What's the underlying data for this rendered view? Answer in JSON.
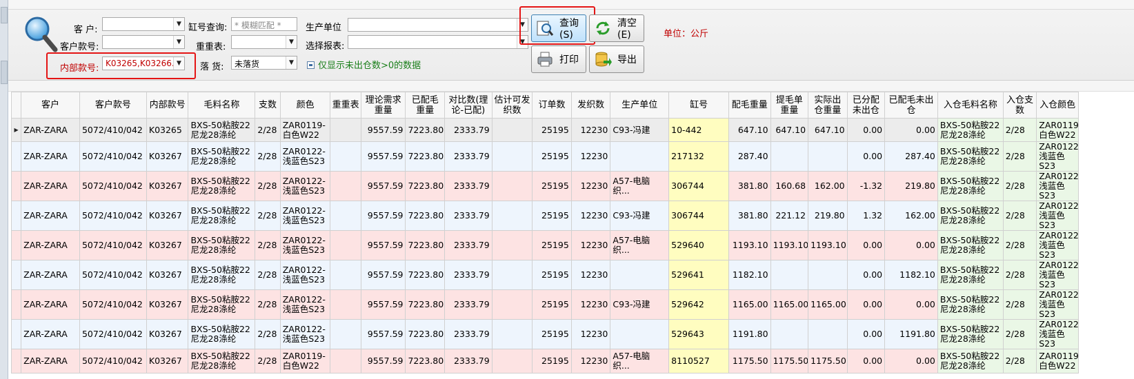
{
  "filters": {
    "customer_label": "客  户:",
    "customer_value": "",
    "customer_no_label": "客户款号:",
    "customer_no_value": "",
    "internal_no_label": "内部款号:",
    "internal_no_value": "K03265,K03266...",
    "vat_label": "缸号查询:",
    "vat_placeholder": "* 模糊匹配 *",
    "reweigh_label": "重重表:",
    "reweigh_value": "",
    "landing_label": "落  货:",
    "landing_value": "未落货",
    "unit_label": "生产单位",
    "unit_value": "",
    "report_label": "选择报表:",
    "report_value": "",
    "checkbox_label": "仅显示未出仓数>0的数据"
  },
  "buttons": {
    "query": "查询(S)",
    "clear": "清空(E)",
    "print": "打印",
    "export": "导出"
  },
  "unit_note": "单位：公斤",
  "table": {
    "headers": [
      "客户",
      "客户款号",
      "内部款号",
      "毛料名称",
      "支数",
      "颜色",
      "重重表",
      "理论需求重量",
      "已配毛重量",
      "对比数(理论-已配)",
      "估计可发织数",
      "订单数",
      "发织数",
      "生产单位",
      "缸号",
      "配毛重量",
      "提毛单重量",
      "实际出仓重量",
      "已分配未出仓",
      "已配毛未出仓",
      "入仓毛料名称",
      "入仓支数",
      "入仓颜色"
    ],
    "rows": [
      {
        "style": "sel",
        "cells": [
          "ZAR-ZARA",
          "5072/410/042",
          "K03265",
          "BXS-50粘胺22尼龙28涤纶",
          "2/28",
          "ZAR0119-白色W22",
          "",
          "9557.59",
          "7223.80",
          "2333.79",
          "",
          "25195",
          "12230",
          "C93-冯建",
          "10-442",
          "647.10",
          "647.10",
          "647.10",
          "0.00",
          "0.00",
          "BXS-50粘胺22尼龙28涤纶",
          "2/28",
          "ZAR0119-白色W22"
        ]
      },
      {
        "style": "blue",
        "cells": [
          "ZAR-ZARA",
          "5072/410/042",
          "K03267",
          "BXS-50粘胺22尼龙28涤纶",
          "2/28",
          "ZAR0122-浅蓝色S23",
          "",
          "9557.59",
          "7223.80",
          "2333.79",
          "",
          "25195",
          "12230",
          "",
          "217132",
          "287.40",
          "",
          "",
          "0.00",
          "287.40",
          "BXS-50粘胺22尼龙28涤纶",
          "2/28",
          "ZAR0122-浅蓝色S23"
        ]
      },
      {
        "style": "pink",
        "cells": [
          "ZAR-ZARA",
          "5072/410/042",
          "K03267",
          "BXS-50粘胺22尼龙28涤纶",
          "2/28",
          "ZAR0122-浅蓝色S23",
          "",
          "9557.59",
          "7223.80",
          "2333.79",
          "",
          "25195",
          "12230",
          "A57-电脑织...",
          "306744",
          "381.80",
          "160.68",
          "162.00",
          "-1.32",
          "219.80",
          "BXS-50粘胺22尼龙28涤纶",
          "2/28",
          "ZAR0122-浅蓝色S23"
        ]
      },
      {
        "style": "blue",
        "cells": [
          "ZAR-ZARA",
          "5072/410/042",
          "K03267",
          "BXS-50粘胺22尼龙28涤纶",
          "2/28",
          "ZAR0122-浅蓝色S23",
          "",
          "9557.59",
          "7223.80",
          "2333.79",
          "",
          "25195",
          "12230",
          "C93-冯建",
          "306744",
          "381.80",
          "221.12",
          "219.80",
          "1.32",
          "162.00",
          "BXS-50粘胺22尼龙28涤纶",
          "2/28",
          "ZAR0122-浅蓝色S23"
        ]
      },
      {
        "style": "pink",
        "cells": [
          "ZAR-ZARA",
          "5072/410/042",
          "K03267",
          "BXS-50粘胺22尼龙28涤纶",
          "2/28",
          "ZAR0122-浅蓝色S23",
          "",
          "9557.59",
          "7223.80",
          "2333.79",
          "",
          "25195",
          "12230",
          "A57-电脑织...",
          "529640",
          "1193.10",
          "1193.10",
          "1193.10",
          "0.00",
          "0.00",
          "BXS-50粘胺22尼龙28涤纶",
          "2/28",
          "ZAR0122-浅蓝色S23"
        ]
      },
      {
        "style": "blue",
        "cells": [
          "ZAR-ZARA",
          "5072/410/042",
          "K03267",
          "BXS-50粘胺22尼龙28涤纶",
          "2/28",
          "ZAR0122-浅蓝色S23",
          "",
          "9557.59",
          "7223.80",
          "2333.79",
          "",
          "25195",
          "12230",
          "",
          "529641",
          "1182.10",
          "",
          "",
          "0.00",
          "1182.10",
          "BXS-50粘胺22尼龙28涤纶",
          "2/28",
          "ZAR0122-浅蓝色S23"
        ]
      },
      {
        "style": "pink",
        "cells": [
          "ZAR-ZARA",
          "5072/410/042",
          "K03267",
          "BXS-50粘胺22尼龙28涤纶",
          "2/28",
          "ZAR0122-浅蓝色S23",
          "",
          "9557.59",
          "7223.80",
          "2333.79",
          "",
          "25195",
          "12230",
          "C93-冯建",
          "529642",
          "1165.00",
          "1165.00",
          "1165.00",
          "0.00",
          "0.00",
          "BXS-50粘胺22尼龙28涤纶",
          "2/28",
          "ZAR0122-浅蓝色S23"
        ]
      },
      {
        "style": "blue",
        "cells": [
          "ZAR-ZARA",
          "5072/410/042",
          "K03267",
          "BXS-50粘胺22尼龙28涤纶",
          "2/28",
          "ZAR0122-浅蓝色S23",
          "",
          "9557.59",
          "7223.80",
          "2333.79",
          "",
          "25195",
          "12230",
          "",
          "529643",
          "1191.80",
          "",
          "",
          "0.00",
          "1191.80",
          "BXS-50粘胺22尼龙28涤纶",
          "2/28",
          "ZAR0122-浅蓝色S23"
        ]
      },
      {
        "style": "pink",
        "cells": [
          "ZAR-ZARA",
          "5072/410/042",
          "K03267",
          "BXS-50粘胺22尼龙28涤纶",
          "2/28",
          "ZAR0119-白色W22",
          "",
          "9557.59",
          "7223.80",
          "2333.79",
          "",
          "25195",
          "12230",
          "A57-电脑织...",
          "8110527",
          "1175.50",
          "1175.50",
          "1175.50",
          "0.00",
          "0.00",
          "BXS-50粘胺22尼龙28涤纶",
          "2/28",
          "ZAR0119-白色W22"
        ]
      }
    ]
  },
  "colors": {
    "row_pink": "#fde3e3",
    "row_blue": "#eef5fd",
    "vat_yellow": "#fffdc0",
    "inbound_green": "#eaf7e6",
    "highlight_red": "#e41414"
  }
}
